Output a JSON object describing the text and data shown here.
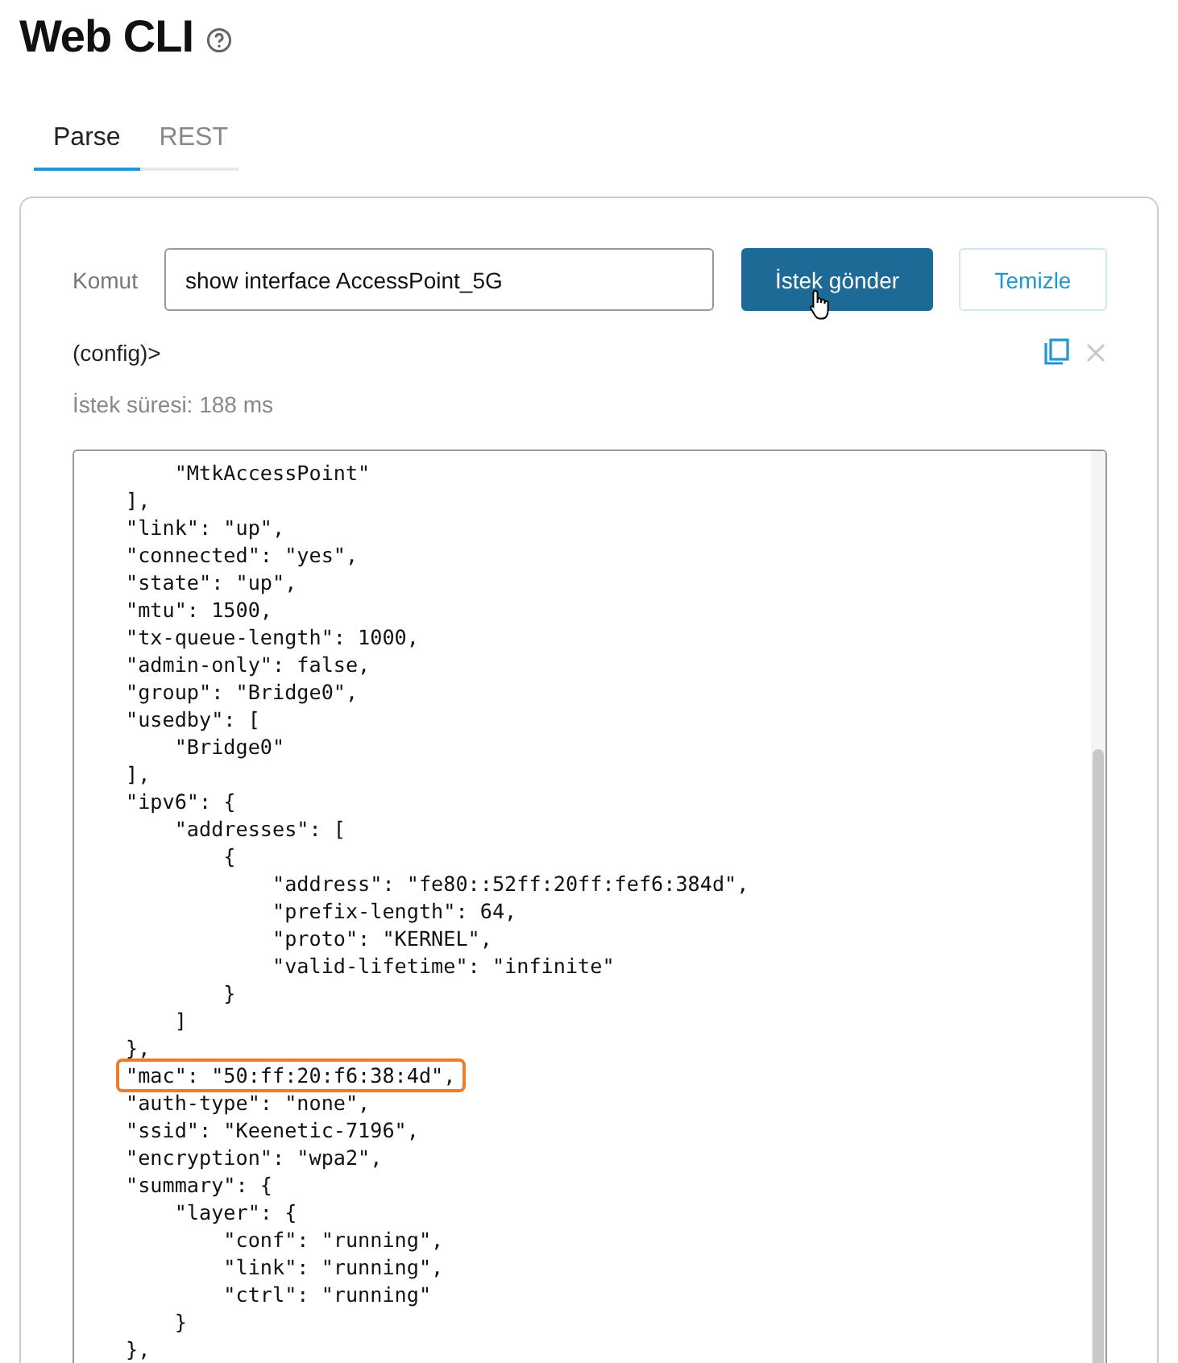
{
  "page": {
    "title": "Web CLI"
  },
  "tabs": [
    {
      "label": "Parse",
      "selected": true
    },
    {
      "label": "REST",
      "selected": false
    }
  ],
  "command": {
    "label": "Komut",
    "value": "show interface AccessPoint_5G"
  },
  "buttons": [
    {
      "label": "İstek gönder",
      "kind": "primary"
    },
    {
      "label": "Temizle",
      "kind": "secondary"
    }
  ],
  "prompt": "(config)>",
  "request_time": "İstek süresi: 188 ms",
  "output": {
    "lines": [
      {
        "text": "    \"MtkAccessPoint\"",
        "highlighted": false
      },
      {
        "text": "],",
        "highlighted": false
      },
      {
        "text": "\"link\": \"up\",",
        "highlighted": false
      },
      {
        "text": "\"connected\": \"yes\",",
        "highlighted": false
      },
      {
        "text": "\"state\": \"up\",",
        "highlighted": false
      },
      {
        "text": "\"mtu\": 1500,",
        "highlighted": false
      },
      {
        "text": "\"tx-queue-length\": 1000,",
        "highlighted": false
      },
      {
        "text": "\"admin-only\": false,",
        "highlighted": false
      },
      {
        "text": "\"group\": \"Bridge0\",",
        "highlighted": false
      },
      {
        "text": "\"usedby\": [",
        "highlighted": false
      },
      {
        "text": "    \"Bridge0\"",
        "highlighted": false
      },
      {
        "text": "],",
        "highlighted": false
      },
      {
        "text": "\"ipv6\": {",
        "highlighted": false
      },
      {
        "text": "    \"addresses\": [",
        "highlighted": false
      },
      {
        "text": "        {",
        "highlighted": false
      },
      {
        "text": "            \"address\": \"fe80::52ff:20ff:fef6:384d\",",
        "highlighted": false
      },
      {
        "text": "            \"prefix-length\": 64,",
        "highlighted": false
      },
      {
        "text": "            \"proto\": \"KERNEL\",",
        "highlighted": false
      },
      {
        "text": "            \"valid-lifetime\": \"infinite\"",
        "highlighted": false
      },
      {
        "text": "        }",
        "highlighted": false
      },
      {
        "text": "    ]",
        "highlighted": false
      },
      {
        "text": "},",
        "highlighted": false
      },
      {
        "text": "\"mac\": \"50:ff:20:f6:38:4d\",",
        "highlighted": true
      },
      {
        "text": "\"auth-type\": \"none\",",
        "highlighted": false
      },
      {
        "text": "\"ssid\": \"Keenetic-7196\",",
        "highlighted": false
      },
      {
        "text": "\"encryption\": \"wpa2\",",
        "highlighted": false
      },
      {
        "text": "\"summary\": {",
        "highlighted": false
      },
      {
        "text": "    \"layer\": {",
        "highlighted": false
      },
      {
        "text": "        \"conf\": \"running\",",
        "highlighted": false
      },
      {
        "text": "        \"link\": \"running\",",
        "highlighted": false
      },
      {
        "text": "        \"ctrl\": \"running\"",
        "highlighted": false
      },
      {
        "text": "    }",
        "highlighted": false
      },
      {
        "text": "},",
        "highlighted": false
      }
    ]
  }
}
